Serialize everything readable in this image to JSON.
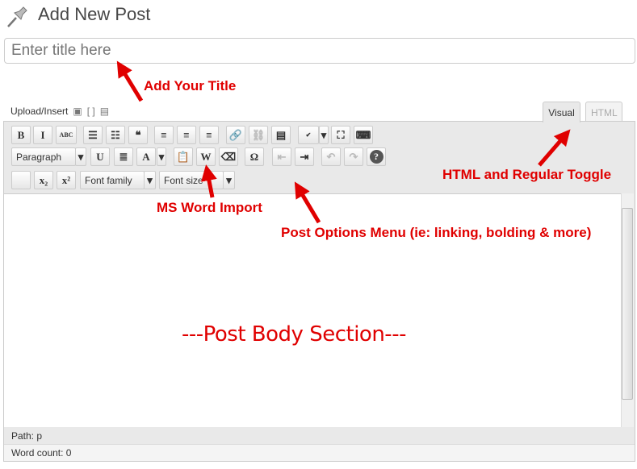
{
  "header": {
    "title": "Add New Post",
    "icon": "pushpin-icon"
  },
  "title_input": {
    "value": "",
    "placeholder": "Enter title here"
  },
  "upload": {
    "label": "Upload/Insert",
    "icons": [
      "add-image-icon",
      "add-media-icon",
      "add-gallery-icon"
    ]
  },
  "tabs": [
    {
      "label": "Visual",
      "active": true
    },
    {
      "label": "HTML",
      "active": false
    }
  ],
  "toolbar": {
    "row1": [
      {
        "n": "bold",
        "t": "B"
      },
      {
        "n": "italic",
        "t": "I"
      },
      {
        "n": "strikethrough",
        "t": "ABC"
      },
      {
        "n": "bullet-list",
        "t": "☰"
      },
      {
        "n": "numbered-list",
        "t": "☷"
      },
      {
        "n": "blockquote",
        "t": "❝"
      },
      {
        "n": "align-left",
        "t": "≡"
      },
      {
        "n": "align-center",
        "t": "≡"
      },
      {
        "n": "align-right",
        "t": "≡"
      },
      {
        "n": "link",
        "t": "🔗",
        "d": true
      },
      {
        "n": "unlink",
        "t": "⛓",
        "d": true
      },
      {
        "n": "insert-more",
        "t": "▤"
      },
      {
        "n": "spellcheck",
        "t": "✔"
      },
      {
        "n": "spellcheck-dropdown",
        "t": "▾"
      },
      {
        "n": "fullscreen",
        "t": "⛶"
      },
      {
        "n": "kitchen-sink",
        "t": "⌨"
      }
    ],
    "row2": [
      {
        "n": "format-select",
        "t": "Paragraph"
      },
      {
        "n": "format-dropdown",
        "t": "▾"
      },
      {
        "n": "underline",
        "t": "U"
      },
      {
        "n": "justify",
        "t": "≣"
      },
      {
        "n": "text-color",
        "t": "A"
      },
      {
        "n": "text-color-dropdown",
        "t": "▾"
      },
      {
        "n": "paste-text",
        "t": "📋"
      },
      {
        "n": "paste-word",
        "t": "W"
      },
      {
        "n": "remove-format",
        "t": "⌫"
      },
      {
        "n": "special-char",
        "t": "Ω"
      },
      {
        "n": "outdent",
        "t": "⇤",
        "d": true
      },
      {
        "n": "indent",
        "t": "⇥"
      },
      {
        "n": "undo",
        "t": "↶",
        "d": true
      },
      {
        "n": "redo",
        "t": "↷",
        "d": true
      },
      {
        "n": "help",
        "t": "?"
      }
    ],
    "row3": [
      {
        "n": "blank",
        "t": ""
      },
      {
        "n": "subscript",
        "t": "x₂"
      },
      {
        "n": "superscript",
        "t": "x²"
      },
      {
        "n": "font-family-select",
        "t": "Font family"
      },
      {
        "n": "font-family-dropdown",
        "t": "▾"
      },
      {
        "n": "font-size-select",
        "t": "Font size"
      },
      {
        "n": "font-size-dropdown",
        "t": "▾"
      }
    ]
  },
  "status": {
    "path_label": "Path:",
    "path_value": "p",
    "word_count": "Word count: 0"
  },
  "annotations": {
    "title": "Add Your Title",
    "toggle": "HTML and Regular Toggle",
    "word": "MS Word Import",
    "options": "Post Options Menu (ie: linking, bolding & more)",
    "body": "---Post Body Section---"
  },
  "colors": {
    "annotation": "#e00000"
  }
}
